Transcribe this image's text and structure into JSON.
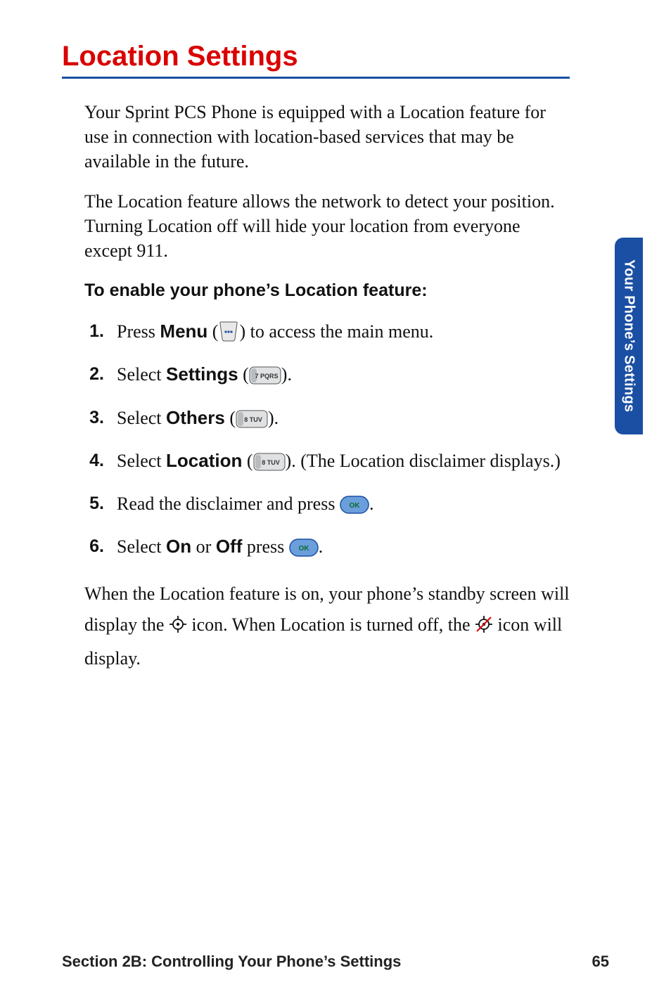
{
  "title": "Location Settings",
  "paragraphs": {
    "p1": "Your Sprint PCS Phone is equipped with a Location feature for use in connection with location-based services that may be available in the future.",
    "p2": "The Location feature allows the network to detect your position. Turning Location off will hide your location from everyone except 911."
  },
  "subhead": "To enable your phone’s Location feature:",
  "steps": {
    "s1_num": "1.",
    "s1_a": "Press ",
    "s1_menu": "Menu",
    "s1_b": " (",
    "s1_c": ") to access the main menu.",
    "s2_num": "2.",
    "s2_a": "Select ",
    "s2_settings": "Settings",
    "s2_b": " (",
    "s2_c": ").",
    "s3_num": "3.",
    "s3_a": "Select ",
    "s3_others": "Others",
    "s3_b": " (",
    "s3_c": ").",
    "s4_num": "4.",
    "s4_a": "Select ",
    "s4_location": "Location",
    "s4_b": " (",
    "s4_c": "). (The Location disclaimer displays.)",
    "s5_num": "5.",
    "s5_a": "Read the disclaimer and press ",
    "s5_b": ".",
    "s6_num": "6.",
    "s6_a": "Select ",
    "s6_on": "On",
    "s6_mid": " or ",
    "s6_off": "Off",
    "s6_b": " press ",
    "s6_c": "."
  },
  "tail": {
    "a": "When the Location feature is on, your phone’s standby screen will display the ",
    "b": " icon. When Location is turned off, the ",
    "c": " icon will display."
  },
  "key_labels": {
    "k7": "7 PQRS",
    "k8": "8 TUV"
  },
  "sidetab": "Your Phone’s Settings",
  "footer": {
    "section": "Section 2B: Controlling Your Phone’s Settings",
    "page": "65"
  }
}
